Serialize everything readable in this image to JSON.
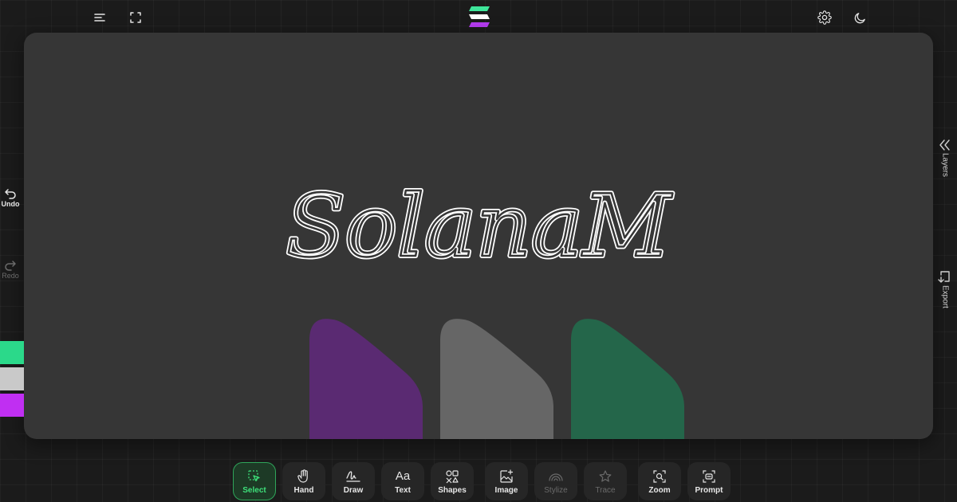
{
  "app": {
    "menu_icon": "menu-lines-icon",
    "fullscreen_icon": "fullscreen-icon",
    "settings_icon": "gear-icon",
    "theme_icon": "moon-icon",
    "logo_colors": [
      "#3ee59a",
      "#ffffff",
      "#b63cf2"
    ]
  },
  "canvas": {
    "signature_text": "SolanaM",
    "shapes": [
      {
        "name": "purple-tab",
        "color": "#5a2a72"
      },
      {
        "name": "gray-tab",
        "color": "#666666"
      },
      {
        "name": "green-tab",
        "color": "#24664a"
      }
    ]
  },
  "left_panel": {
    "undo_label": "Undo",
    "redo_label": "Redo",
    "swatches": [
      "#2bd98a",
      "#c9c9c9",
      "#c02ff2"
    ]
  },
  "right_panel": {
    "layers_label": "Layers",
    "export_label": "Export"
  },
  "toolbar": {
    "tools": [
      {
        "label": "Select",
        "icon": "select-cursor-icon",
        "active": true
      },
      {
        "label": "Hand",
        "icon": "hand-icon"
      },
      {
        "label": "Draw",
        "icon": "signature-pen-icon"
      },
      {
        "label": "Text",
        "icon": "text-aa-icon"
      },
      {
        "label": "Shapes",
        "icon": "shapes-icon"
      },
      {
        "label": "Image",
        "icon": "image-plus-icon"
      },
      {
        "label": "Stylize",
        "icon": "rainbow-icon",
        "disabled": true
      },
      {
        "label": "Trace",
        "icon": "star-sparkle-icon",
        "disabled": true
      },
      {
        "label": "Zoom",
        "icon": "zoom-icon"
      },
      {
        "label": "Prompt",
        "icon": "prompt-icon"
      }
    ]
  }
}
